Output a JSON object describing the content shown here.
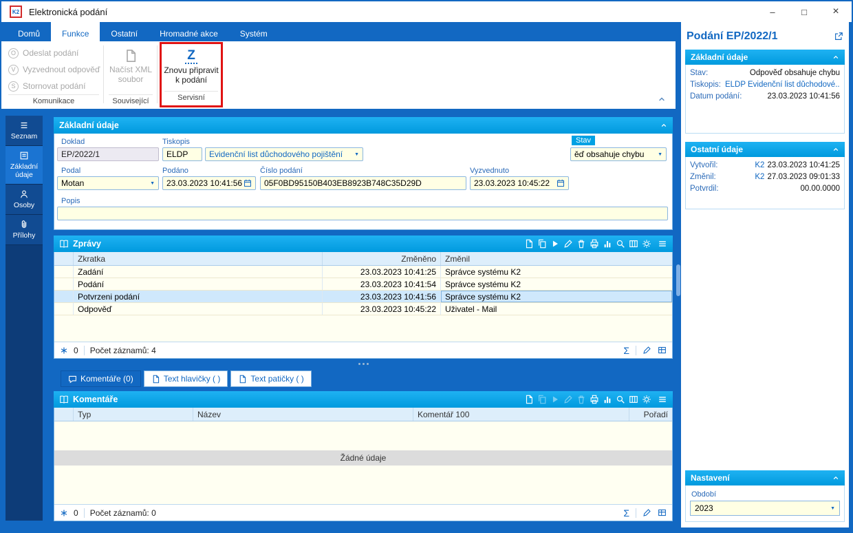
{
  "window": {
    "title": "Elektronická podání",
    "logo": "K2",
    "controls": {
      "minimize": "–",
      "maximize": "□",
      "close": "×"
    }
  },
  "ribbon": {
    "tabs": [
      "Domů",
      "Funkce",
      "Ostatní",
      "Hromadné akce",
      "Systém"
    ],
    "groups": {
      "komunikace": {
        "label": "Komunikace",
        "items": [
          {
            "letter": "O",
            "label": "Odeslat podání"
          },
          {
            "letter": "V",
            "label": "Vyzvednout odpověď"
          },
          {
            "letter": "S",
            "label": "Stornovat podání"
          }
        ]
      },
      "souvisejici": {
        "label": "Související",
        "button_line1": "Načíst XML",
        "button_line2": "soubor"
      },
      "servisni": {
        "label": "Servisní",
        "letter": "Z",
        "button_line1": "Znovu připravit",
        "button_line2": "k podání"
      }
    }
  },
  "sidebar": {
    "items": [
      {
        "label": "Seznam"
      },
      {
        "label": "Základní údaje"
      },
      {
        "label": "Osoby"
      },
      {
        "label": "Přílohy"
      }
    ]
  },
  "form": {
    "section_title": "Základní údaje",
    "doklad": {
      "label": "Doklad",
      "value": "EP/2022/1"
    },
    "tiskopis": {
      "label": "Tiskopis",
      "code": "ELDP",
      "name": "Evidenční list důchodového pojištění"
    },
    "stav": {
      "label": "Stav",
      "value": "ěď obsahuje chybu"
    },
    "podal": {
      "label": "Podal",
      "value": "Motan"
    },
    "podano": {
      "label": "Podáno",
      "value": "23.03.2023 10:41:56"
    },
    "cislo_podani": {
      "label": "Číslo podání",
      "value": "05F0BD95150B403EB8923B748C35D29D"
    },
    "vyzvednuto": {
      "label": "Vyzvednuto",
      "value": "23.03.2023 10:45:22"
    },
    "popis": {
      "label": "Popis",
      "value": ""
    }
  },
  "zpravy": {
    "title": "Zprávy",
    "columns": [
      "Zkratka",
      "Změněno",
      "Změnil"
    ],
    "rows": [
      {
        "zkratka": "Zadání",
        "zmeneno": "23.03.2023 10:41:25",
        "zmenil": "Správce systému K2",
        "selected": false
      },
      {
        "zkratka": "Podání",
        "zmeneno": "23.03.2023 10:41:54",
        "zmenil": "Správce systému K2",
        "selected": false
      },
      {
        "zkratka": "Potvrzeni podání",
        "zmeneno": "23.03.2023 10:41:56",
        "zmenil": "Správce systému K2",
        "selected": true
      },
      {
        "zkratka": "Odpověď",
        "zmeneno": "23.03.2023 10:45:22",
        "zmenil": "Uživatel - Mail",
        "selected": false
      }
    ],
    "footer": {
      "counter": "0",
      "records": "Počet záznamů: 4"
    }
  },
  "subtabs": {
    "tabs": [
      "Komentáře (0)",
      "Text hlavičky ( )",
      "Text patičky ( )"
    ]
  },
  "komentare": {
    "title": "Komentáře",
    "columns": [
      "Typ",
      "Název",
      "Komentář 100",
      "Pořadí"
    ],
    "empty_text": "Žádné údaje",
    "footer": {
      "counter": "0",
      "records": "Počet záznamů: 0"
    }
  },
  "right_panel": {
    "title": "Podání EP/2022/1",
    "zakladni": {
      "title": "Základní údaje",
      "rows": [
        {
          "label": "Stav:",
          "value": "Odpověď obsahuje chybu"
        },
        {
          "label": "Tiskopis:",
          "value": "ELDP Evidenční list důchodové..."
        },
        {
          "label": "Datum podání:",
          "value": "23.03.2023 10:41:56"
        }
      ]
    },
    "ostatni": {
      "title": "Ostatní údaje",
      "rows": [
        {
          "label": "Vytvořil:",
          "user": "K2",
          "datetime": "23.03.2023 10:41:25"
        },
        {
          "label": "Změnil:",
          "user": "K2",
          "datetime": "27.03.2023 09:01:33"
        },
        {
          "label": "Potvrdil:",
          "user": "",
          "datetime": "00.00.0000"
        }
      ]
    },
    "nastaveni": {
      "title": "Nastavení",
      "obdobi_label": "Období",
      "obdobi_value": "2023"
    }
  },
  "icons": {
    "sum": "Σ",
    "dropdown": "▼"
  }
}
